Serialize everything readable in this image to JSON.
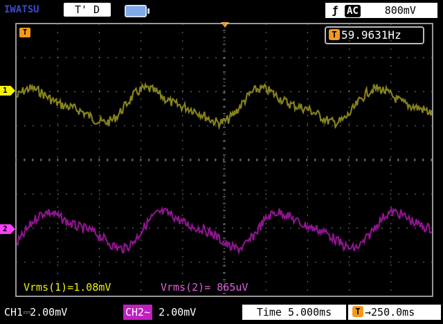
{
  "header": {
    "brand": "IWATSU",
    "trigger_status": "T' D",
    "trigger_slope_icon": "slope-falling-icon",
    "coupling_badge": "AC",
    "trigger_level": "800mV"
  },
  "markers": {
    "trigger_position_label": "T",
    "ch1_marker": "1",
    "ch2_marker": "2"
  },
  "frequency": {
    "icon_label": "T",
    "value": "59.9631Hz"
  },
  "measurements": {
    "ch1": "Vrms(1)=1.08mV",
    "ch2": "Vrms(2)= 865uV"
  },
  "footer": {
    "ch1_label": "CH1",
    "ch1_coupling_symbol": "⎓",
    "ch1_scale": "2.00mV",
    "ch2_label": "CH2",
    "ch2_coupling_symbol": "~",
    "ch2_scale": "2.00mV",
    "time_label": "Time",
    "time_value": "5.000ms",
    "delay_label": "T",
    "delay_value": "→250.0ms"
  },
  "colors": {
    "ch1": "#86821c",
    "ch2": "#8e148e",
    "trigger": "#f39a1a",
    "grid": "#7a7a7a",
    "frame": "#cccccc"
  }
}
